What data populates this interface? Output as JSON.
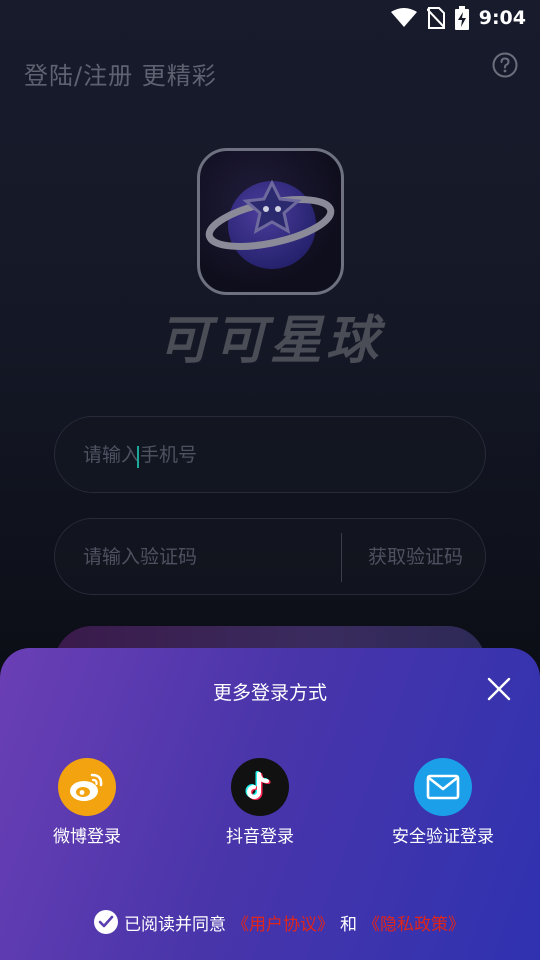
{
  "status": {
    "time": "9:04"
  },
  "header": {
    "title": "登陆/注册 更精彩"
  },
  "app": {
    "name": "可可星球"
  },
  "form": {
    "phone_placeholder": "请输入手机号",
    "code_placeholder": "请输入验证码",
    "get_code_label": "获取验证码"
  },
  "sheet": {
    "title": "更多登录方式",
    "options": [
      {
        "label": "微博登录",
        "icon": "weibo-icon",
        "color": "#f2a30f"
      },
      {
        "label": "抖音登录",
        "icon": "tiktok-icon",
        "color": "#111111"
      },
      {
        "label": "安全验证登录",
        "icon": "mail-icon",
        "color": "#1b9fe8"
      }
    ],
    "agreement": {
      "prefix": "已阅读并同意",
      "user_agreement": "《用户协议》",
      "and": "和",
      "privacy_policy": "《隐私政策》"
    }
  },
  "colors": {
    "accent_red": "#e0251b",
    "sheet_start": "#6b3fb5",
    "sheet_end": "#2f32b0"
  }
}
